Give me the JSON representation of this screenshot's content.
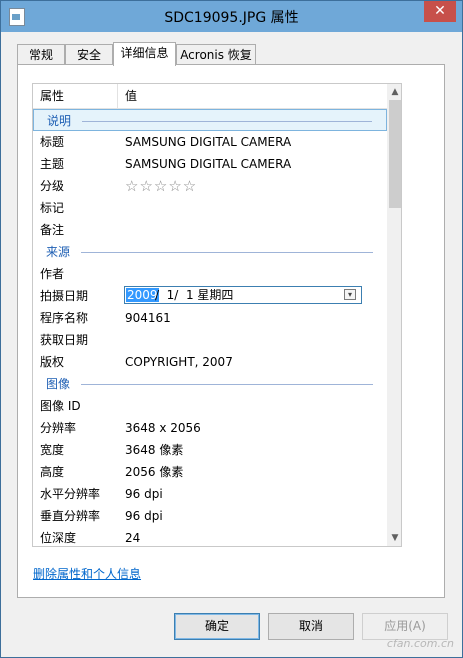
{
  "window": {
    "title": "SDC19095.JPG 属性",
    "close_label": "✕"
  },
  "tabs": [
    {
      "label": "常规"
    },
    {
      "label": "安全"
    },
    {
      "label": "详细信息"
    },
    {
      "label": "Acronis 恢复"
    }
  ],
  "active_tab": "详细信息",
  "list": {
    "headers": {
      "property": "属性",
      "value": "值"
    },
    "groups": {
      "description": "说明",
      "origin": "来源",
      "image": "图像"
    },
    "rows": {
      "title": {
        "key": "标题",
        "value": "SAMSUNG DIGITAL CAMERA"
      },
      "subject": {
        "key": "主题",
        "value": "SAMSUNG DIGITAL CAMERA"
      },
      "rating": {
        "key": "分级",
        "stars": "☆☆☆☆☆",
        "value": 0,
        "max": 5
      },
      "tags": {
        "key": "标记",
        "value": ""
      },
      "comments": {
        "key": "备注",
        "value": ""
      },
      "authors": {
        "key": "作者",
        "value": ""
      },
      "date_taken": {
        "key": "拍摄日期",
        "selected": "2009",
        "rest": "/  1/  1 星期四"
      },
      "program": {
        "key": "程序名称",
        "value": "904161"
      },
      "date_acquired": {
        "key": "获取日期",
        "value": ""
      },
      "copyright": {
        "key": "版权",
        "value": "COPYRIGHT, 2007"
      },
      "image_id": {
        "key": "图像 ID",
        "value": ""
      },
      "dimensions": {
        "key": "分辨率",
        "value": "3648 x 2056"
      },
      "width": {
        "key": "宽度",
        "value": "3648 像素"
      },
      "height": {
        "key": "高度",
        "value": "2056 像素"
      },
      "hres": {
        "key": "水平分辨率",
        "value": "96 dpi"
      },
      "vres": {
        "key": "垂直分辨率",
        "value": "96 dpi"
      },
      "bitdepth": {
        "key": "位深度",
        "value": "24"
      }
    }
  },
  "remove_link": "删除属性和个人信息",
  "buttons": {
    "ok": "确定",
    "cancel": "取消",
    "apply": "应用(A)"
  },
  "watermark": "cfan.com.cn"
}
